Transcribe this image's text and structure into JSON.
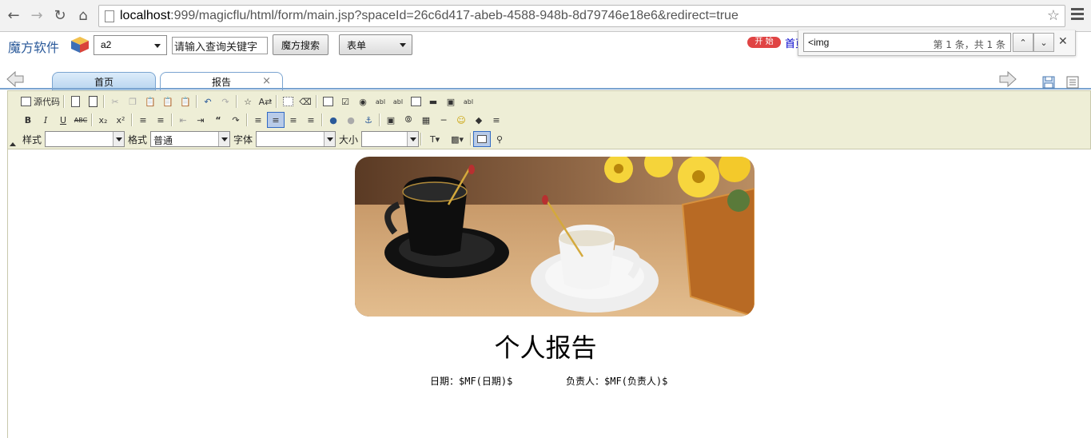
{
  "browser": {
    "url_host": "localhost",
    "url_rest": ":999/magicflu/html/form/main.jsp?spaceId=26c6d417-abeb-4588-948b-8d79746e18e6&redirect=true"
  },
  "header": {
    "logo_text": "魔方软件",
    "space_select_value": "a2",
    "search_placeholder": "请输入查询关键字",
    "search_button": "魔方搜索",
    "form_select_value": "表单",
    "start_badge": "开 始",
    "home_link": "首页"
  },
  "find_bar": {
    "query": "<img",
    "count": "第 1 条，共 1 条"
  },
  "tabs": [
    {
      "label": "首页"
    },
    {
      "label": "报告"
    }
  ],
  "toolbar": {
    "source_label": "源代码",
    "style_label": "样式",
    "format_label": "格式",
    "format_value": "普通",
    "font_label": "字体",
    "size_label": "大小"
  },
  "document": {
    "title": "个人报告",
    "date_field": "日期：$MF(日期)$",
    "owner_field": "负责人：$MF(负责人)$"
  },
  "colors": {
    "tab_border": "#7aa4d0",
    "toolbar_bg": "#eeeed6",
    "logo_blue": "#2b5a9a",
    "start_red": "#e04444"
  }
}
